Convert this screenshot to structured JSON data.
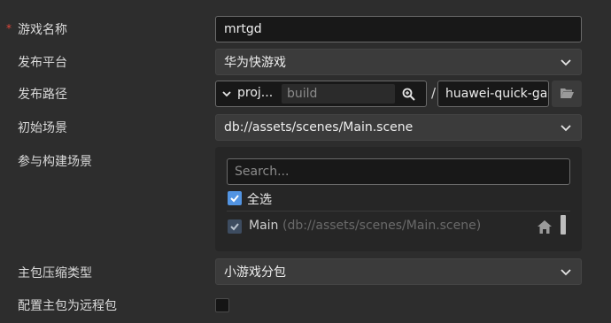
{
  "form": {
    "game_name": {
      "label": "游戏名称",
      "required_mark": "*",
      "value": "mrtgd"
    },
    "platform": {
      "label": "发布平台",
      "value": "华为快游戏"
    },
    "build_path": {
      "label": "发布路径",
      "prefix": "proj...",
      "build_placeholder": "build",
      "separator": "/",
      "folder_value": "huawei-quick-game"
    },
    "start_scene": {
      "label": "初始场景",
      "value": "db://assets/scenes/Main.scene"
    },
    "build_scenes": {
      "label": "参与构建场景",
      "search_placeholder": "Search...",
      "select_all_label": "全选",
      "select_all_checked": true,
      "scenes": [
        {
          "name": "Main",
          "path": "(db://assets/scenes/Main.scene)",
          "checked": true
        }
      ]
    },
    "compression": {
      "label": "主包压缩类型",
      "value": "小游戏分包"
    },
    "remote_main": {
      "label": "配置主包为远程包",
      "checked": false
    }
  },
  "colors": {
    "accent": "#5294e2",
    "required": "#e0463a",
    "background": "#2d2d2d"
  },
  "icons": [
    "chevron-down-icon",
    "search-icon",
    "folder-icon",
    "home-icon",
    "check-icon"
  ]
}
